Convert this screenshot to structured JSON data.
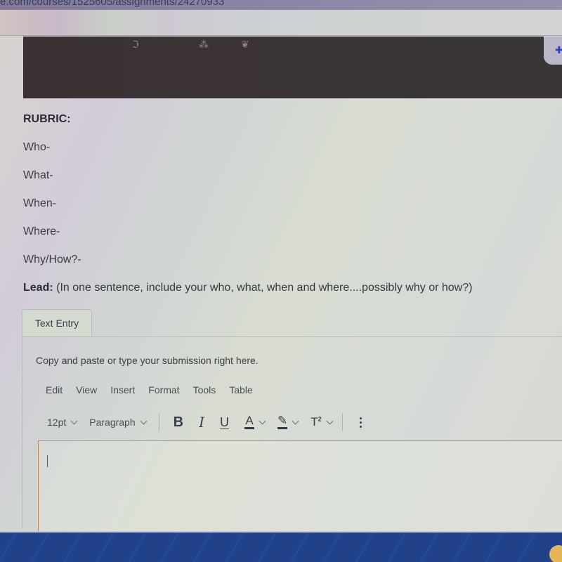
{
  "browser": {
    "url_fragment": "e.com/courses/1525605/assignments/24270933"
  },
  "rubric": {
    "title": "RUBRIC:",
    "items": [
      "Who-",
      "What-",
      "When-",
      "Where-",
      "Why/How?-"
    ],
    "lead_label": "Lead:",
    "lead_text": " (In one sentence, include your who, what, when and where....possibly why or how?)"
  },
  "submission": {
    "tabs": [
      {
        "label": "Text Entry",
        "active": true
      }
    ],
    "instructions": "Copy and paste or type your submission right here.",
    "menu": [
      "Edit",
      "View",
      "Insert",
      "Format",
      "Tools",
      "Table"
    ],
    "toolbar": {
      "font_size": "12pt",
      "block_format": "Paragraph",
      "bold": "B",
      "italic": "I",
      "underline": "U",
      "text_color": "A",
      "superscript": "T",
      "superscript_mark": "2"
    },
    "editor_value": ""
  },
  "icons": {
    "side_widget": "puzzle-icon",
    "more": "more-vertical-icon",
    "highlight": "highlighter-icon"
  },
  "colors": {
    "editor_focus_border": "#c48a52",
    "taskbar": "#21438d",
    "banner": "#3a3234"
  }
}
